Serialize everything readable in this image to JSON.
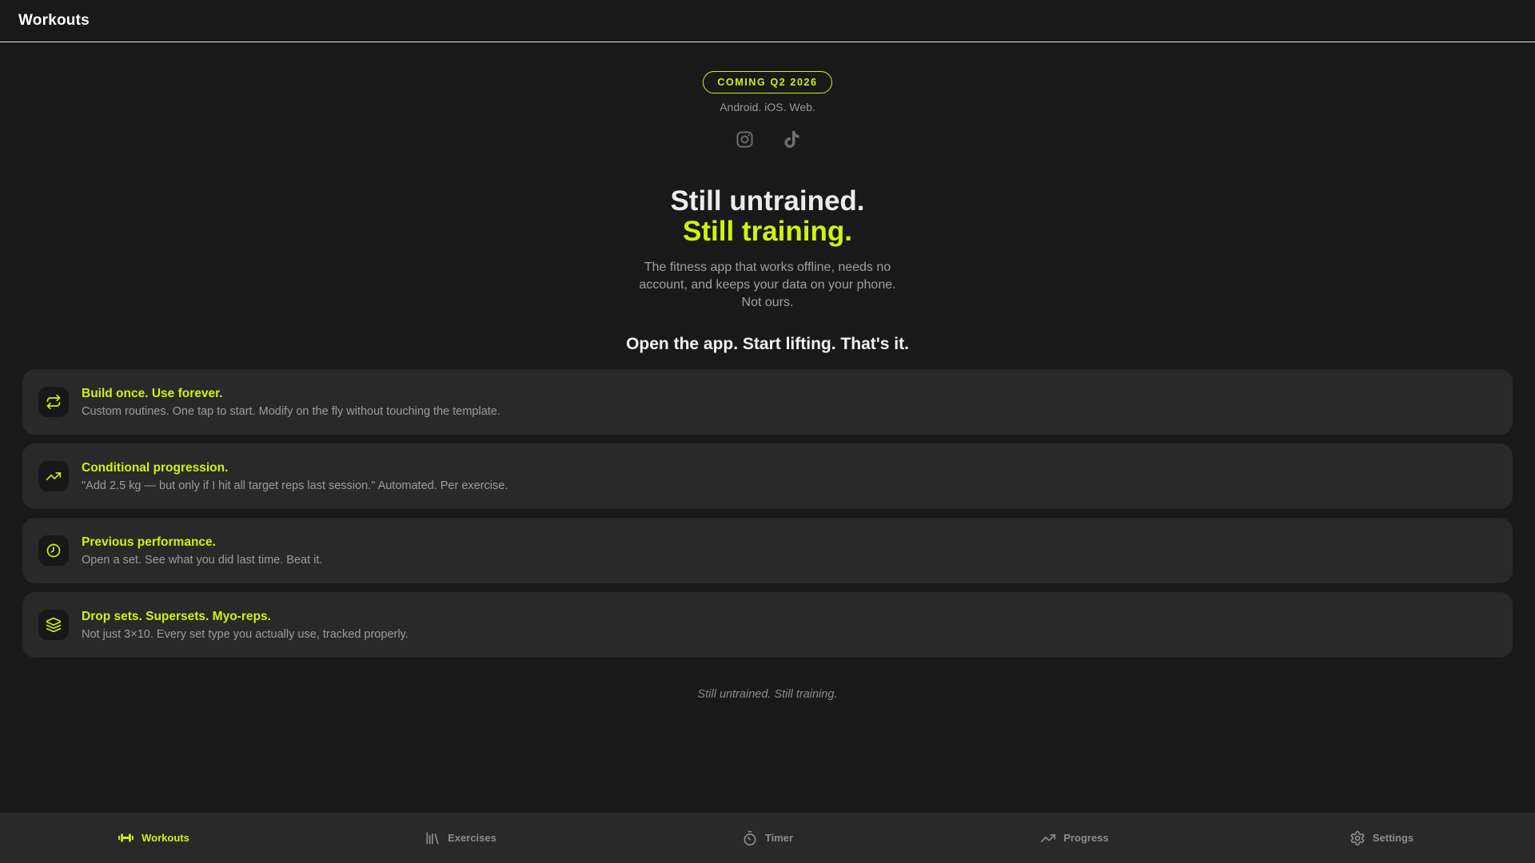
{
  "header": {
    "title": "Workouts"
  },
  "hero": {
    "badge": "COMING Q2 2026",
    "platforms": "Android. iOS. Web.",
    "social_icons": [
      "instagram-icon",
      "tiktok-icon"
    ],
    "heading_line1": "Still untrained.",
    "heading_line2": "Still training.",
    "description_lines": [
      "The fitness app that works offline, needs no",
      "account, and keeps your data on your phone.",
      "Not ours."
    ],
    "cta": "Open the app. Start lifting. That's it."
  },
  "features": [
    {
      "icon": "repeat-icon",
      "title": "Build once. Use forever.",
      "description": "Custom routines. One tap to start. Modify on the fly without touching the template."
    },
    {
      "icon": "trending-up-icon",
      "title": "Conditional progression.",
      "description": "\"Add 2.5 kg — but only if I hit all target reps last session.\" Automated. Per exercise."
    },
    {
      "icon": "clock-icon",
      "title": "Previous performance.",
      "description": "Open a set. See what you did last time. Beat it."
    },
    {
      "icon": "layers-icon",
      "title": "Drop sets. Supersets. Myo-reps.",
      "description": "Not just 3×10. Every set type you actually use, tracked properly."
    }
  ],
  "footer_tagline": "Still untrained. Still training.",
  "nav": {
    "items": [
      {
        "label": "Workouts",
        "icon": "dumbbell-icon",
        "active": true
      },
      {
        "label": "Exercises",
        "icon": "library-icon",
        "active": false
      },
      {
        "label": "Timer",
        "icon": "timer-icon",
        "active": false
      },
      {
        "label": "Progress",
        "icon": "trending-up-icon",
        "active": false
      },
      {
        "label": "Settings",
        "icon": "gear-icon",
        "active": false
      }
    ]
  },
  "colors": {
    "accent": "#d0f20e",
    "background": "#191919",
    "card": "#292929"
  }
}
